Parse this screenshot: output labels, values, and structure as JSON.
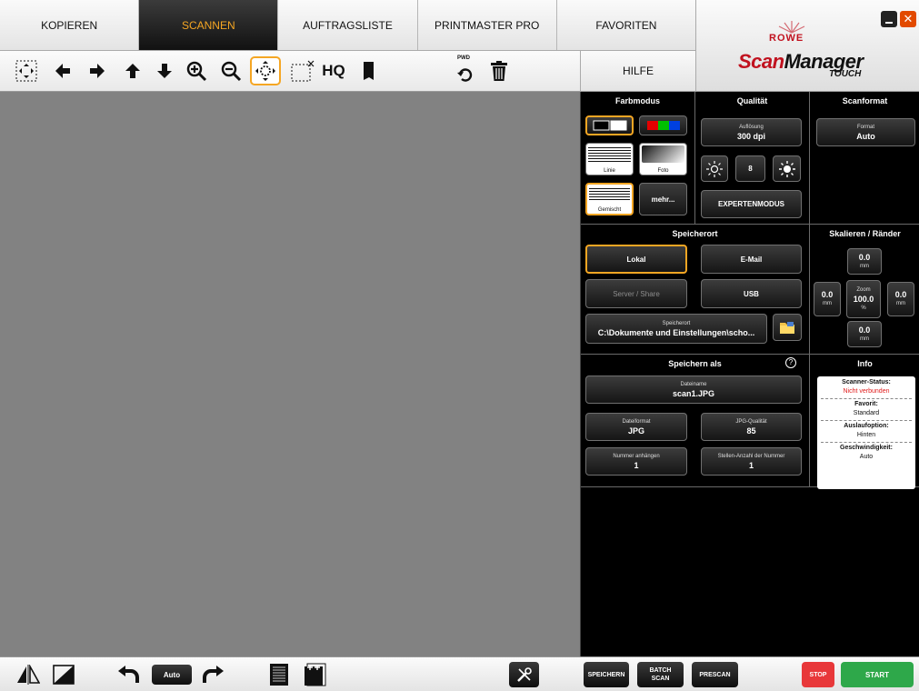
{
  "tabs": [
    {
      "label": "KOPIEREN"
    },
    {
      "label": "SCANNEN"
    },
    {
      "label": "AUFTRAGSLISTE"
    },
    {
      "label": "PRINTMASTER PRO"
    },
    {
      "label": "FAVORITEN"
    }
  ],
  "active_tab": "SCANNEN",
  "hilfe": "HILFE",
  "brand": {
    "rowe": "ROWE",
    "scan": "Scan",
    "manager": "Manager",
    "touch": "TOUCH"
  },
  "toolbar": {
    "hq_label": "HQ",
    "pwd_label": "PWD",
    "icons": [
      "fit-to-window-icon",
      "arrow-left-icon",
      "arrow-right-icon",
      "arrow-up-icon",
      "arrow-down-icon",
      "zoom-in-icon",
      "zoom-out-icon",
      "move-center-icon",
      "select-area-icon",
      "hq-icon",
      "document-icon",
      "undo-pwd-icon",
      "trash-icon"
    ]
  },
  "farbmodus": {
    "title": "Farbmodus",
    "linie": "Linie",
    "foto": "Foto",
    "gemischt": "Gemischt",
    "mehr": "mehr..."
  },
  "qualitaet": {
    "title": "Qualität",
    "aufloesung_label": "Auflösung",
    "aufloesung_value": "300 dpi",
    "brightness_value": "8",
    "expertenmodus": "EXPERTENMODUS"
  },
  "scanformat": {
    "title": "Scanformat",
    "format_label": "Format",
    "format_value": "Auto"
  },
  "speicherort": {
    "title": "Speicherort",
    "lokal": "Lokal",
    "email": "E-Mail",
    "server": "Server / Share",
    "usb": "USB",
    "path_label": "Speicherort",
    "path_value": "C:\\Dokumente und Einstellungen\\scho..."
  },
  "skalieren": {
    "title": "Skalieren / Ränder",
    "top_value": "0.0",
    "left_value": "0.0",
    "right_value": "0.0",
    "bottom_value": "0.0",
    "unit_mm": "mm",
    "zoom_label": "Zoom",
    "zoom_value": "100.0",
    "unit_pct": "%"
  },
  "speichern_als": {
    "title": "Speichern als",
    "help": "?",
    "dateiname_label": "Dateiname",
    "dateiname_value": "scan1.JPG",
    "dateiformat_label": "Dateiformat",
    "dateiformat_value": "JPG",
    "jpg_quality_label": "JPG-Qualität",
    "jpg_quality_value": "85",
    "nummer_label": "Nummer anhängen",
    "nummer_value": "1",
    "stellen_label": "Stellen-Anzahl der Nummer",
    "stellen_value": "1"
  },
  "info": {
    "title": "Info",
    "scanner_status_label": "Scanner-Status:",
    "scanner_status_value": "Nicht verbunden",
    "favorit_label": "Favorit:",
    "favorit_value": "Standard",
    "auslauf_label": "Auslaufoption:",
    "auslauf_value": "Hinten",
    "speed_label": "Geschwindigkeit:",
    "speed_value": "Auto"
  },
  "bottom": {
    "auto": "Auto",
    "speichern": "SPEICHERN",
    "batch_1": "BATCH",
    "batch_2": "SCAN",
    "prescan": "PRESCAN",
    "stop": "STOP",
    "start": "START"
  },
  "colors": {
    "accent": "#f5a623",
    "stop": "#e8383a",
    "start": "#2ea84a",
    "brand_red": "#c1121f",
    "error": "#e01c1c"
  }
}
